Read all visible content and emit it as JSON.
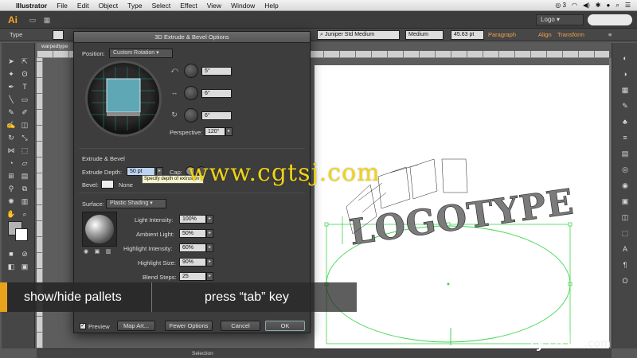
{
  "menubar": {
    "app_name": "Illustrator",
    "items": [
      "File",
      "Edit",
      "Object",
      "Type",
      "Select",
      "Effect",
      "View",
      "Window",
      "Help"
    ],
    "badge": "3"
  },
  "appbar": {
    "logo": "Ai",
    "workspace": "Logo"
  },
  "controlbar": {
    "tool_label": "Type",
    "font_name": "Juniper Std Medium",
    "font_style": "Medium",
    "font_size": "45.63 pt",
    "paragraph_label": "Paragraph",
    "align_label": "Align",
    "transform_label": "Transform"
  },
  "document": {
    "tab_label": "warpedtype"
  },
  "dialog": {
    "title": "3D Extrude & Bevel Options",
    "position_label": "Position:",
    "position_value": "Custom Rotation",
    "rotation_x": "5°",
    "rotation_y": "6°",
    "rotation_z": "6°",
    "perspective_label": "Perspective:",
    "perspective_value": "120°",
    "extrude_section": "Extrude & Bevel",
    "extrude_depth_label": "Extrude Depth:",
    "extrude_depth_value": "50 pt",
    "cap_label": "Cap:",
    "bevel_label": "Bevel:",
    "bevel_value": "None",
    "tooltip": "Specify depth of extrusion",
    "surface_label": "Surface:",
    "surface_value": "Plastic Shading",
    "light_intensity_label": "Light Intensity:",
    "light_intensity_value": "100%",
    "ambient_light_label": "Ambient Light:",
    "ambient_light_value": "50%",
    "highlight_intensity_label": "Highlight Intensity:",
    "highlight_intensity_value": "60%",
    "highlight_size_label": "Highlight Size:",
    "highlight_size_value": "90%",
    "blend_steps_label": "Blend Steps:",
    "blend_steps_value": "25",
    "preview_label": "Preview",
    "map_art_label": "Map Art...",
    "fewer_options_label": "Fewer Options",
    "cancel_label": "Cancel",
    "ok_label": "OK"
  },
  "artwork": {
    "text": "LOGOTYPE"
  },
  "lower_third": {
    "left_text": "show/hide pallets",
    "right_text": "press “tab” key"
  },
  "watermark": "www.cgtsj.com",
  "branding": {
    "lynda": "lynda",
    "lynda_suffix": ".com"
  },
  "statusbar": {
    "mode": "Selection"
  },
  "colors": {
    "accent": "#e8a21b",
    "cube_face": "#5fa7b5",
    "guide_green": "#3cd64c"
  }
}
